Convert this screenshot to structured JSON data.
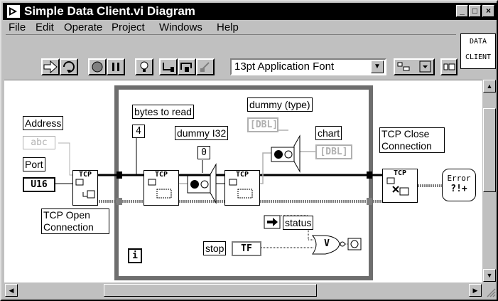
{
  "window": {
    "title": "Simple Data Client.vi Diagram",
    "controls": [
      "_",
      "□",
      "×"
    ]
  },
  "menu": [
    {
      "label": "File"
    },
    {
      "label": "Edit"
    },
    {
      "label": "Operate"
    },
    {
      "label": "Project"
    },
    {
      "label": "Windows"
    },
    {
      "label": "Help"
    }
  ],
  "toolbar": {
    "font_select": "13pt Application Font",
    "icons": [
      "run-arrow-icon",
      "run-continuous-icon",
      "abort-icon",
      "pause-icon",
      "highlight-execution-icon",
      "step-into-icon",
      "step-over-icon",
      "step-out-icon"
    ]
  },
  "vi_icon": {
    "line1": "DATA",
    "line2": "CLIENT"
  },
  "diagram": {
    "address_label": "Address",
    "address_const": "abc",
    "port_label": "Port",
    "port_const": "U16",
    "tcp_open_label": "TCP Open Connection",
    "bytes_label": "bytes to read",
    "bytes_const": "4",
    "dummy_i32_label": "dummy I32",
    "dummy_i32_const": "0",
    "dummy_type_label": "dummy (type)",
    "dummy_type_const": "DBL",
    "chart_label": "chart",
    "chart_const": "DBL",
    "status_label": "status",
    "stop_label": "stop",
    "stop_const": "TF",
    "tcp_close_label": "TCP Close Connection",
    "tcp_tag": "TCP",
    "iteration": "i",
    "error_text": "Error",
    "error_sym": "?!+",
    "or_sym": "V"
  }
}
